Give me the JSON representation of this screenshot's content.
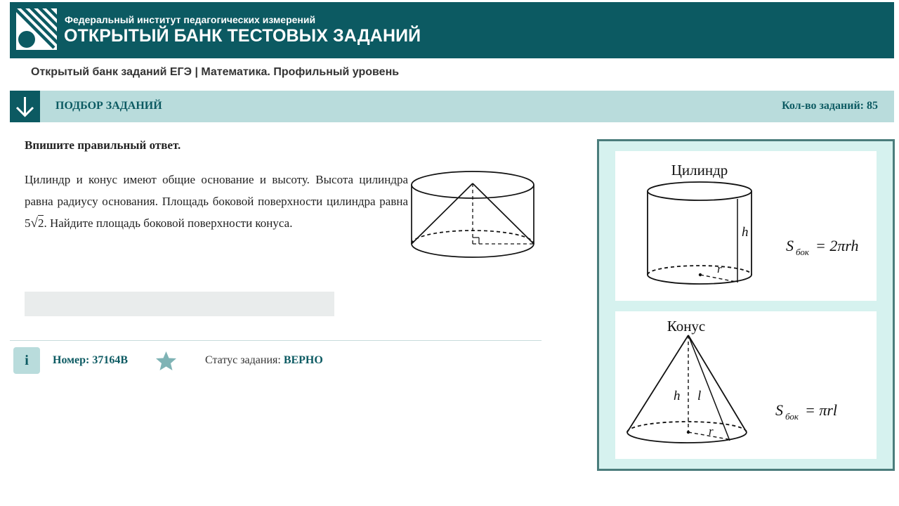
{
  "header": {
    "institute": "Федеральный институт педагогических измерений",
    "bank_title": "ОТКРЫТЫЙ БАНК ТЕСТОВЫХ ЗАДАНИЙ"
  },
  "subtitle": "Открытый банк заданий ЕГЭ | Математика. Профильный уровень",
  "selection_bar": {
    "label": "ПОДБОР ЗАДАНИЙ",
    "count_text": "Кол-во заданий: 85"
  },
  "task": {
    "instruction": "Впишите правильный ответ.",
    "text_before": "Цилиндр и конус имеют общие основание и высоту. Высота цилиндра равна радиусу основания. Площадь боковой поверхности цилиндра равна ",
    "coef": "5",
    "radicand": "2",
    "text_after": ". Найдите площадь боковой поверхности конуса.",
    "answer_value": ""
  },
  "footer": {
    "info_label": "i",
    "number_text": "Номер: 37164B",
    "status_label": "Статус задания: ",
    "status_value": "ВЕРНО"
  },
  "reference": {
    "cylinder": {
      "title": "Цилиндр",
      "h": "h",
      "r": "r",
      "S": "S",
      "sub": "бок",
      "rhs": "= 2πrh"
    },
    "cone": {
      "title": "Конус",
      "h": "h",
      "l": "l",
      "r": "r",
      "S": "S",
      "sub": "бок",
      "rhs": "= πrl"
    }
  },
  "colors": {
    "header": "#0c5a62",
    "bar": "#b9dcdc",
    "panel_bg": "#d6f2ef",
    "panel_border": "#4b7d7c",
    "star": "#7fb3b5"
  },
  "icons": [
    "fipi-logo-icon",
    "arrow-down-icon",
    "info-icon",
    "star-icon"
  ]
}
